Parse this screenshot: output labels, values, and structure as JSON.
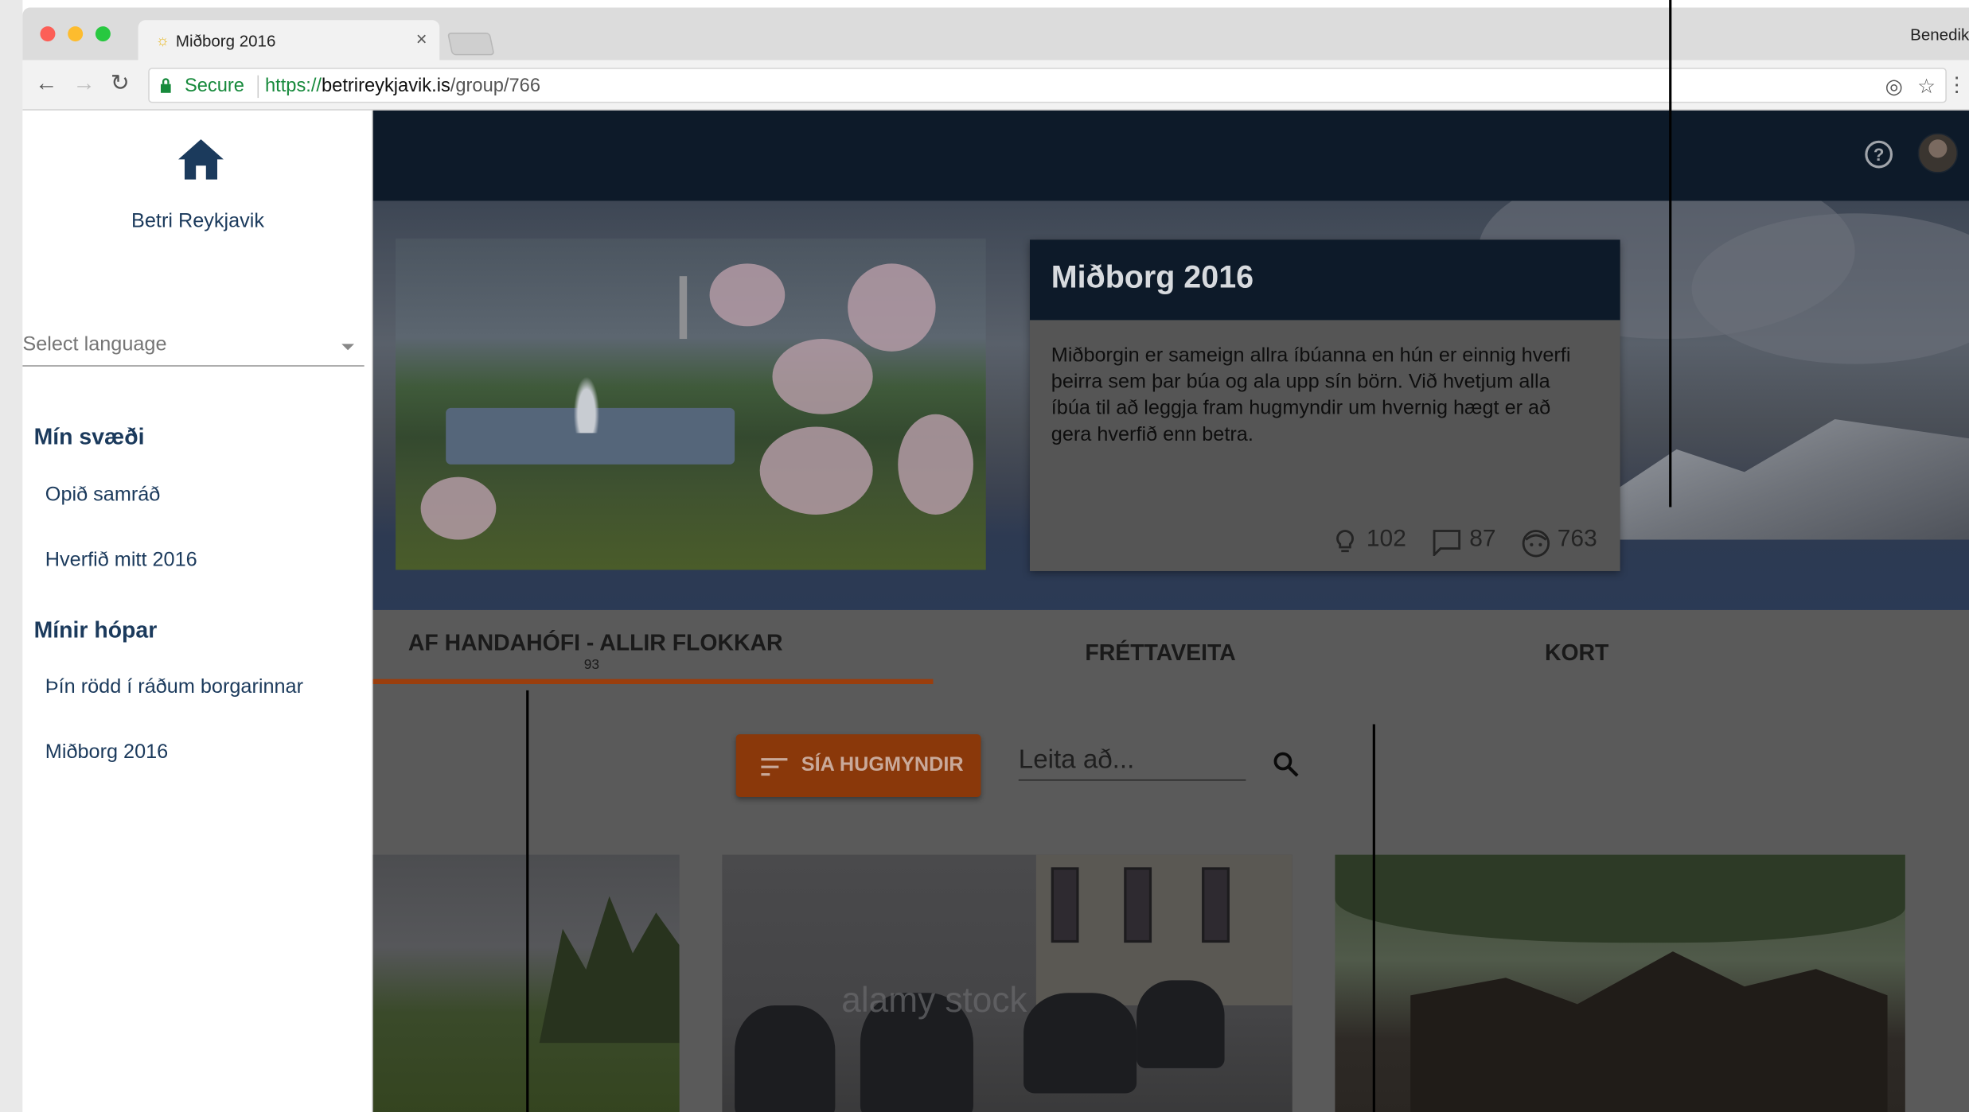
{
  "browser": {
    "tab_title": "Miðborg 2016",
    "profile_name": "Benedik",
    "secure_label": "Secure",
    "url_protocol": "https://",
    "url_host": "betrireykjavik.is",
    "url_path": "/group/766"
  },
  "sidebar": {
    "brand": "Betri Reykjavik",
    "language_placeholder": "Select language",
    "sections": [
      {
        "title": "Mín svæði",
        "items": [
          "Opið samráð",
          "Hverfið mitt 2016"
        ]
      },
      {
        "title": "Mínir hópar",
        "items": [
          "Þín rödd í ráðum borgarinnar",
          "Miðborg 2016"
        ]
      }
    ]
  },
  "group": {
    "title": "Miðborg 2016",
    "description": "Miðborgin er sameign allra íbúanna en hún er einnig hverfi þeirra sem þar búa og ala upp sín börn. Við hvetjum alla íbúa til að leggja fram hugmyndir um hvernig hægt er að gera hverfið enn betra.",
    "stats": {
      "ideas": "102",
      "comments": "87",
      "users": "763"
    }
  },
  "tabs": [
    {
      "label": "AF HANDAHÓFI - ALLIR FLOKKAR",
      "count": "93",
      "active": true
    },
    {
      "label": "FRÉTTAVEITA"
    },
    {
      "label": "KORT"
    }
  ],
  "filter": {
    "button_label": "SÍA HUGMYNDIR"
  },
  "search": {
    "placeholder": "Leita að..."
  },
  "cards": {
    "watermark": "alamy stock"
  },
  "colors": {
    "primary_dark": "#0d1a29",
    "brand_text": "#1b3a5c",
    "accent": "#e0651a",
    "secure_green": "#178a3c"
  }
}
